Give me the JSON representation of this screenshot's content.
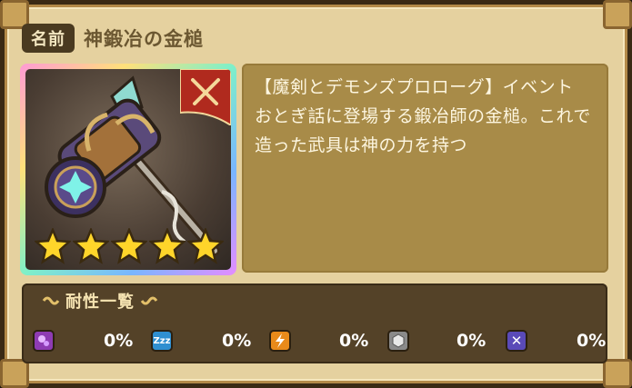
{
  "item": {
    "name_tag": "名前",
    "name": "神鍛冶の金槌",
    "description": "【魔剣とデモンズプロローグ】イベント おとぎ話に登場する鍛冶師の金槌。これで造った武具は神の力を持つ",
    "rarity_stars": 5,
    "type_icon": "crossed-swords-icon"
  },
  "resistance": {
    "title": "耐性一覧",
    "items": [
      {
        "icon": "poison-bubbles-icon",
        "color": "#8e3bb3",
        "value": "0%"
      },
      {
        "icon": "sleep-zzz-icon",
        "color": "#2f8fd0",
        "value": "0%"
      },
      {
        "icon": "lightning-icon",
        "color": "#e88a1a",
        "value": "0%"
      },
      {
        "icon": "stone-hexagon-icon",
        "color": "#8a8a8a",
        "value": "0%"
      },
      {
        "icon": "cross-x-icon",
        "color": "#5a4ab8",
        "value": "0%"
      }
    ]
  }
}
